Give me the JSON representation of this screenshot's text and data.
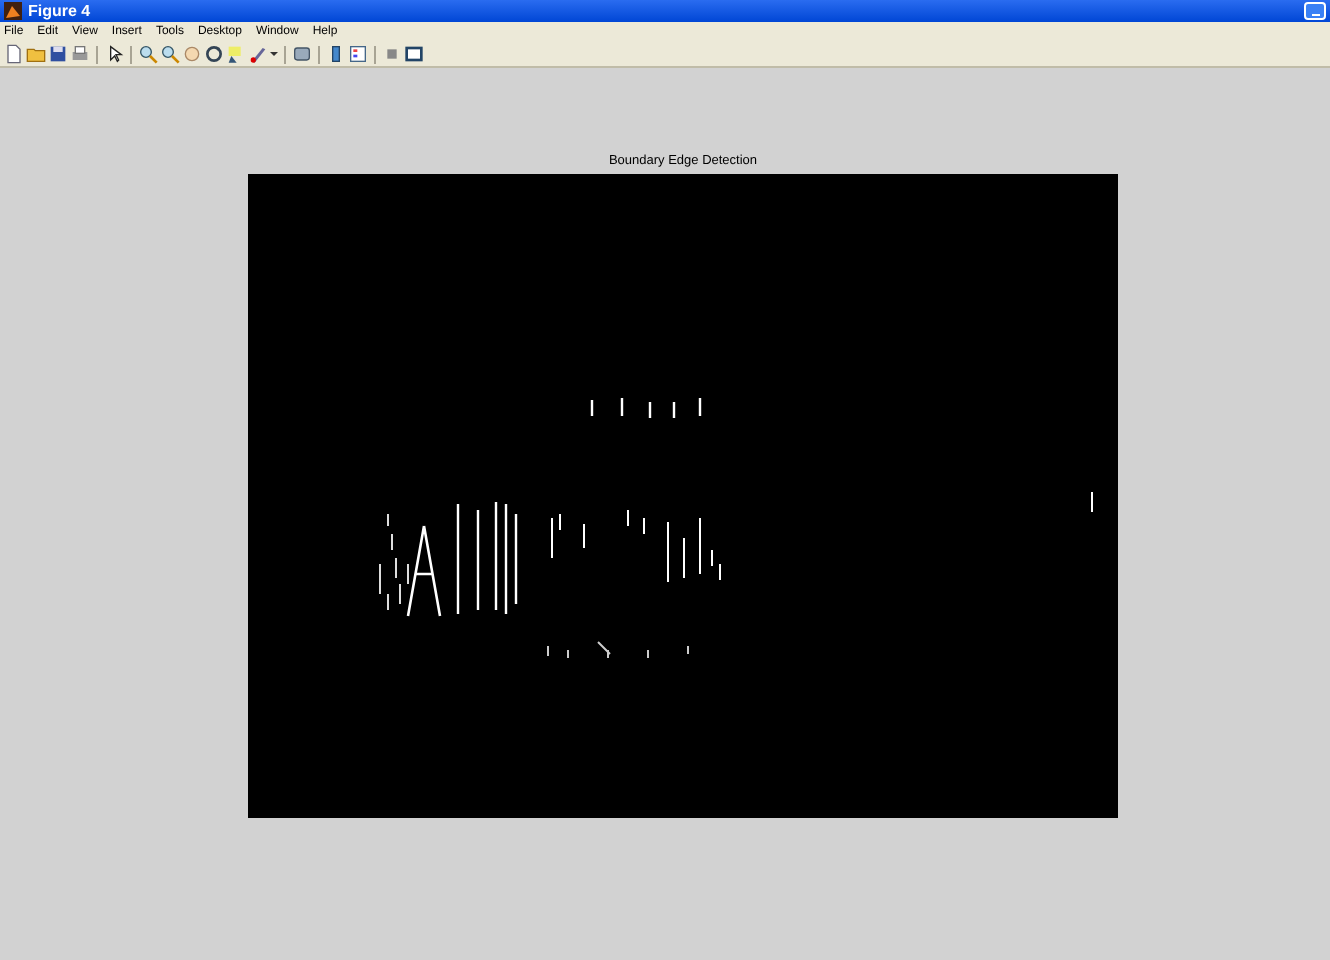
{
  "window": {
    "title": "Figure 4"
  },
  "menu": [
    "File",
    "Edit",
    "View",
    "Insert",
    "Tools",
    "Desktop",
    "Window",
    "Help"
  ],
  "axes": {
    "title": "Boundary Edge Detection"
  }
}
